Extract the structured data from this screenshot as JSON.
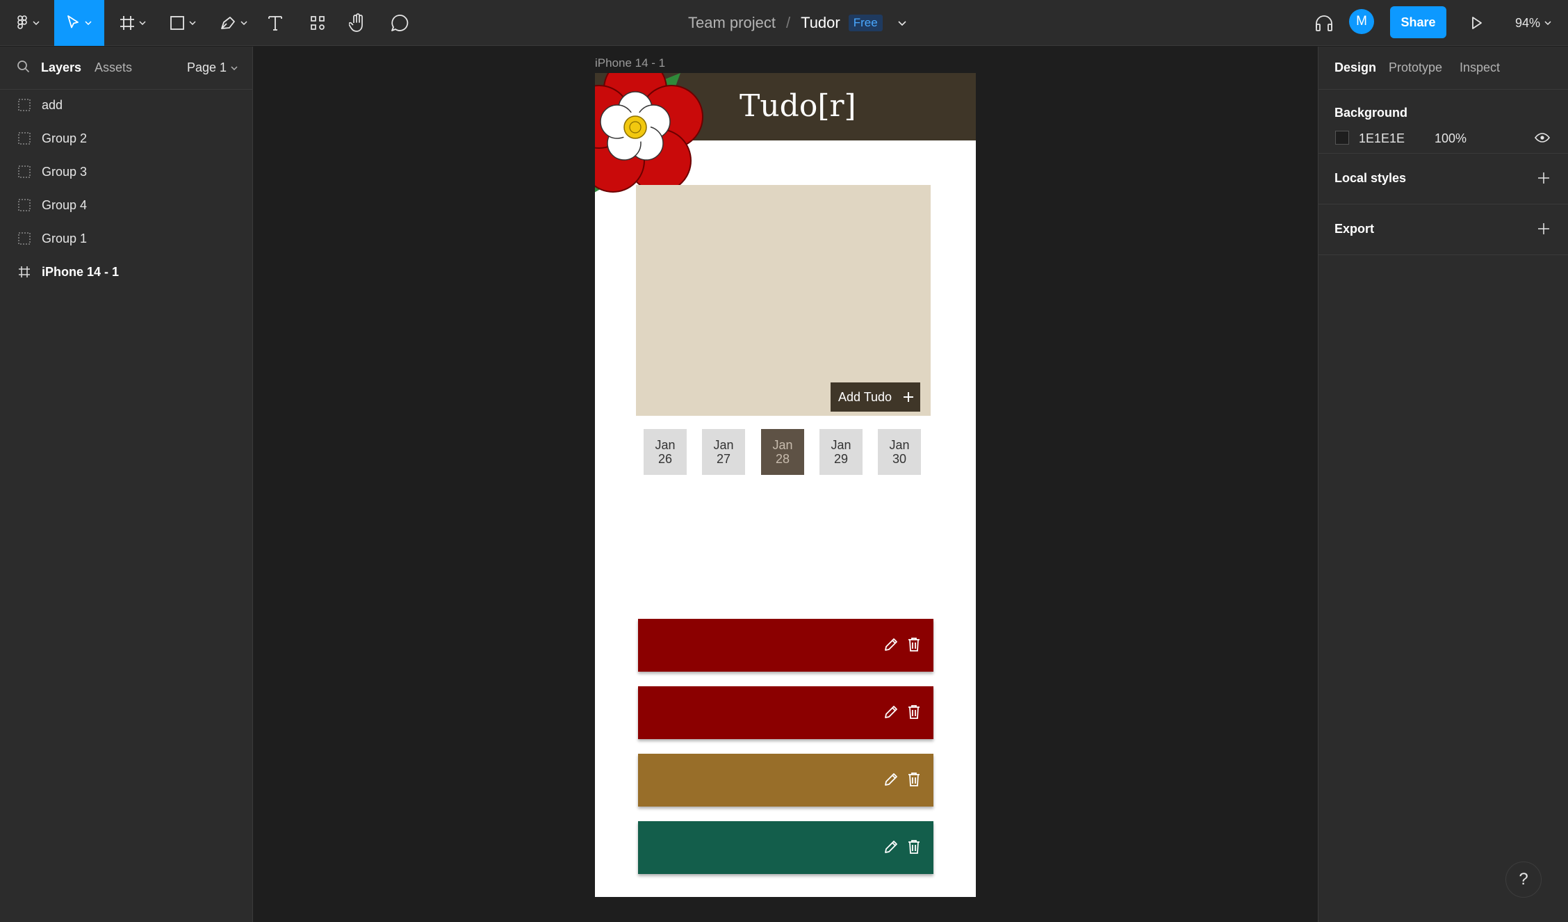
{
  "toolbar": {
    "title": {
      "project": "Team project",
      "separator": "/",
      "file": "Tudor",
      "badge": "Free"
    },
    "avatar_initial": "M",
    "share_label": "Share",
    "zoom": "94%",
    "accent": "#0d99ff"
  },
  "left_panel": {
    "tabs": {
      "layers": "Layers",
      "assets": "Assets"
    },
    "page": "Page 1",
    "layers": [
      {
        "label": "add",
        "icon": "group-icon"
      },
      {
        "label": "Group 2",
        "icon": "group-icon"
      },
      {
        "label": "Group 3",
        "icon": "group-icon"
      },
      {
        "label": "Group 4",
        "icon": "group-icon"
      },
      {
        "label": "Group 1",
        "icon": "group-icon"
      },
      {
        "label": "iPhone 14 - 1",
        "icon": "frame-icon"
      }
    ]
  },
  "right_panel": {
    "tabs": {
      "design": "Design",
      "prototype": "Prototype",
      "inspect": "Inspect"
    },
    "background": {
      "title": "Background",
      "hex": "1E1E1E",
      "opacity": "100%"
    },
    "local_styles": "Local styles",
    "export": "Export",
    "help": "?"
  },
  "canvas": {
    "frame_label": "iPhone 14 - 1",
    "app": {
      "title": "Tudo[r]",
      "add_button": "Add Tudo",
      "dates": [
        {
          "month": "Jan",
          "day": "26"
        },
        {
          "month": "Jan",
          "day": "27"
        },
        {
          "month": "Jan",
          "day": "28",
          "selected": true
        },
        {
          "month": "Jan",
          "day": "29"
        },
        {
          "month": "Jan",
          "day": "30"
        }
      ],
      "task_colors": [
        "#8b0000",
        "#8b0000",
        "#986e29",
        "#135e4b"
      ],
      "header_color": "#3f3628",
      "card_color": "#e0d6c2"
    }
  }
}
